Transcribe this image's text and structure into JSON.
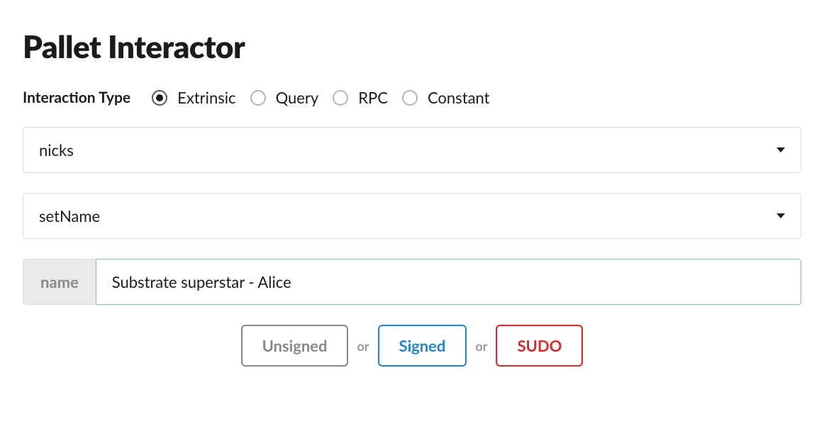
{
  "title": "Pallet Interactor",
  "interaction": {
    "label": "Interaction Type",
    "options": [
      "Extrinsic",
      "Query",
      "RPC",
      "Constant"
    ],
    "selected": "Extrinsic"
  },
  "palletDropdown": {
    "value": "nicks"
  },
  "callDropdown": {
    "value": "setName"
  },
  "paramInput": {
    "label": "name",
    "value": "Substrate superstar - Alice"
  },
  "buttons": {
    "unsigned": "Unsigned",
    "signed": "Signed",
    "sudo": "SUDO",
    "separator": "or"
  }
}
